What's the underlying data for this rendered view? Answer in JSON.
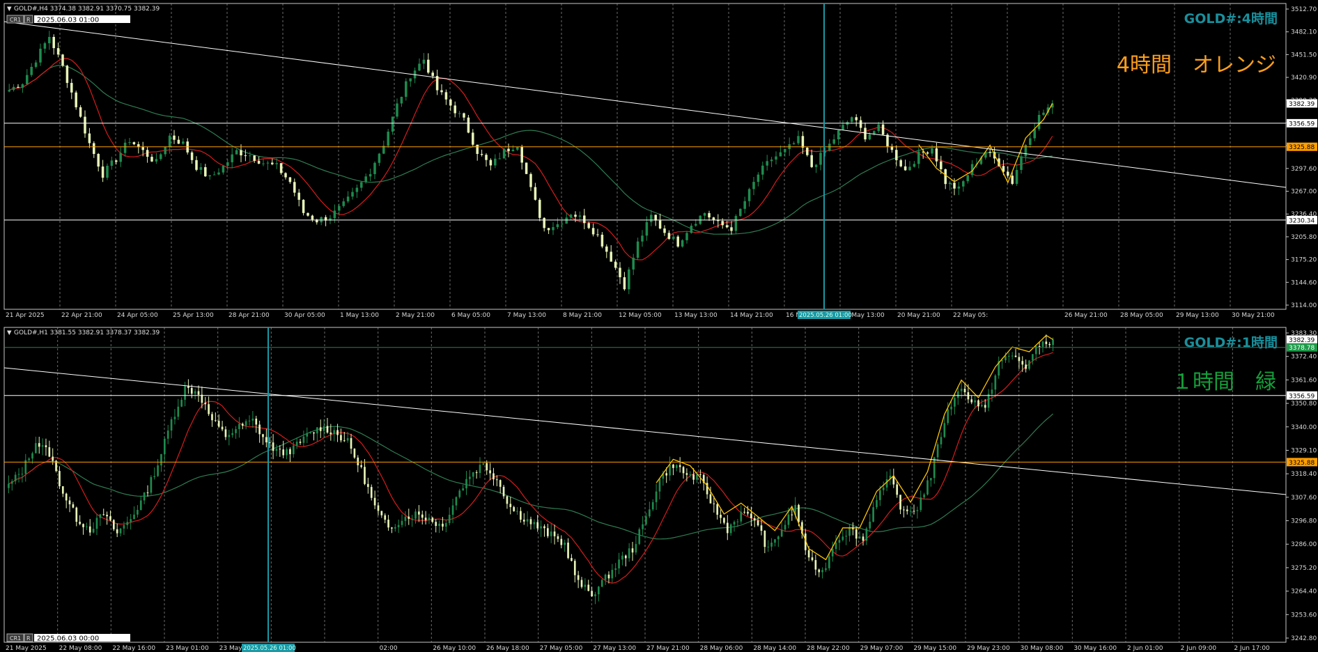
{
  "top": {
    "header": "GOLD#,H4  3374.38 3382.91 3370.75 3382.39",
    "crosshair_time": "2025.06.03 01:00",
    "btn_cr": "CR1",
    "btn_r": "R",
    "watermark": "GOLD#:4時間",
    "note": "4時間　オレンジ",
    "x_labels": [
      "21 Apr 2025",
      "22 Apr 21:00",
      "24 Apr 05:00",
      "25 Apr 13:00",
      "28 Apr 21:00",
      "30 Apr 05:00",
      "1 May 13:00",
      "2 May 21:00",
      "6 May 05:00",
      "7 May 13:00",
      "8 May 21:00",
      "12 May 05:00",
      "13 May 13:00",
      "14 May 21:00",
      "16 May 05:00",
      "19 May 13:00",
      "20 May 21:00",
      "22 May 05:",
      "2025.05.26 01:00",
      "26 May 21:00",
      "28 May 05:00",
      "29 May 13:00",
      "30 May 21:00"
    ],
    "y_ticks": [
      "3512.70",
      "3482.10",
      "3451.50",
      "3420.90",
      "3390.30",
      "3359.70",
      "3329.10",
      "3297.60",
      "3267.00",
      "3236.40",
      "3205.80",
      "3175.20",
      "3144.60",
      "3114.00"
    ],
    "level_labels": [
      "3382.39",
      "3356.59",
      "3325.88",
      "3230.34"
    ]
  },
  "bottom": {
    "header": "GOLD#,H1  3381.55 3382.91 3378.37 3382.39",
    "crosshair_time": "2025.06.03 00:00",
    "btn_cr": "CR1",
    "btn_r": "R",
    "watermark": "GOLD#:1時間",
    "note": "１時間　緑",
    "x_labels": [
      "21 May 2025",
      "22 May 08:00",
      "22 May 16:00",
      "23 May 01:00",
      "23 May 09:00",
      "23 M",
      "2025.05.26 01:00",
      "02:00",
      "26 May 10:00",
      "26 May 18:00",
      "27 May 05:00",
      "27 May 13:00",
      "27 May 21:00",
      "28 May 06:00",
      "28 May 14:00",
      "28 May 22:00",
      "29 May 07:00",
      "29 May 15:00",
      "29 May 23:00",
      "30 May 08:00",
      "30 May 16:00",
      "2 Jun 01:00",
      "2 Jun 09:00",
      "2 Jun 17:00"
    ],
    "y_ticks": [
      "3383.30",
      "3372.40",
      "3361.60",
      "3350.80",
      "3340.00",
      "3329.10",
      "3318.40",
      "3307.60",
      "3296.80",
      "3286.00",
      "3275.20",
      "3264.40",
      "3253.60",
      "3242.80"
    ],
    "level_labels": [
      "3382.39",
      "3378.78",
      "3356.59",
      "3325.88"
    ]
  },
  "colors": {
    "background": "#000000",
    "bull": "#1e8b4e",
    "bear": "#e8f5b8",
    "ma_fast": "#d91c1c",
    "ma_slow": "#2e7d52",
    "zigzag": "#ffc400",
    "trendline": "#ffffff",
    "orange_level": "#ff9f00",
    "vline": "#1a9aa6",
    "watermark": "#1a8f9c",
    "note_top": "#ff9f1c",
    "note_bottom": "#14a03a",
    "grid": "#9a9a9a"
  },
  "chart_data": [
    {
      "type": "candlestick",
      "title": "GOLD#,H4",
      "ylim": [
        3114.0,
        3512.7
      ],
      "levels": [
        3356.59,
        3325.88,
        3230.34
      ],
      "last_price": 3382.39,
      "ohlc_last": {
        "open": 3374.38,
        "high": 3382.91,
        "low": 3370.75,
        "close": 3382.39
      },
      "close_path": [
        3400,
        3410,
        3440,
        3470,
        3430,
        3380,
        3330,
        3290,
        3310,
        3335,
        3320,
        3305,
        3340,
        3330,
        3300,
        3285,
        3300,
        3320,
        3315,
        3305,
        3300,
        3280,
        3240,
        3230,
        3235,
        3250,
        3270,
        3295,
        3330,
        3380,
        3420,
        3440,
        3400,
        3380,
        3360,
        3320,
        3300,
        3320,
        3330,
        3270,
        3220,
        3225,
        3240,
        3230,
        3210,
        3180,
        3145,
        3200,
        3235,
        3215,
        3200,
        3225,
        3240,
        3225,
        3220,
        3255,
        3290,
        3310,
        3320,
        3335,
        3300,
        3320,
        3345,
        3365,
        3340,
        3350,
        3320,
        3295,
        3315,
        3325,
        3280,
        3270,
        3300,
        3320,
        3305,
        3280,
        3330,
        3365,
        3382.39
      ]
    },
    {
      "type": "candlestick",
      "title": "GOLD#,H1",
      "ylim": [
        3242.8,
        3388.0
      ],
      "levels": [
        3378.78,
        3356.59,
        3325.88
      ],
      "last_price": 3382.39,
      "ohlc_last": {
        "open": 3381.55,
        "high": 3382.91,
        "low": 3378.37,
        "close": 3382.39
      },
      "close_path": [
        3315,
        3322,
        3335,
        3330,
        3312,
        3300,
        3295,
        3302,
        3293,
        3300,
        3310,
        3325,
        3345,
        3360,
        3358,
        3345,
        3338,
        3342,
        3345,
        3335,
        3330,
        3332,
        3338,
        3342,
        3340,
        3335,
        3322,
        3305,
        3295,
        3300,
        3302,
        3300,
        3296,
        3310,
        3320,
        3325,
        3318,
        3305,
        3300,
        3296,
        3292,
        3288,
        3270,
        3265,
        3272,
        3280,
        3286,
        3300,
        3318,
        3325,
        3320,
        3318,
        3305,
        3295,
        3302,
        3300,
        3285,
        3295,
        3305,
        3280,
        3275,
        3290,
        3295,
        3290,
        3310,
        3318,
        3302,
        3305,
        3320,
        3345,
        3360,
        3355,
        3350,
        3372,
        3375,
        3370,
        3380,
        3382.39
      ]
    }
  ]
}
